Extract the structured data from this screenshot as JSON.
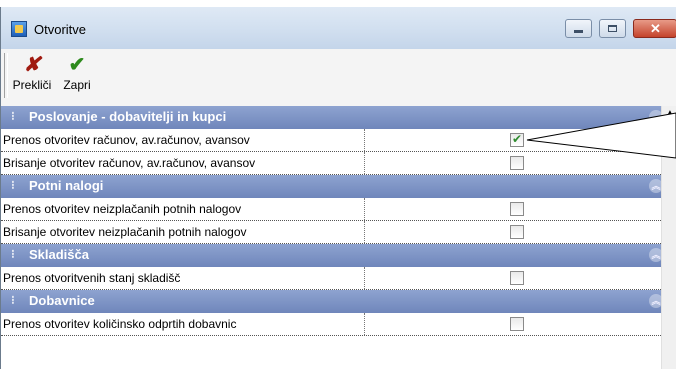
{
  "window": {
    "title": "Otvoritve"
  },
  "toolbar": {
    "cancel_label": "Prekliči",
    "close_label": "Zapri"
  },
  "groups": [
    {
      "title": "Poslovanje - dobavitelji in kupci",
      "items": [
        {
          "label": "Prenos otvoritev računov, av.računov, avansov",
          "checked": true
        },
        {
          "label": "Brisanje otvoritev računov, av.računov, avansov",
          "checked": false
        }
      ]
    },
    {
      "title": "Potni nalogi",
      "items": [
        {
          "label": "Prenos otvoritev neizplačanih potnih nalogov",
          "checked": false
        },
        {
          "label": "Brisanje otvoritev neizplačanih potnih nalogov",
          "checked": false
        }
      ]
    },
    {
      "title": "Skladišča",
      "items": [
        {
          "label": "Prenos otvoritvenih stanj skladišč",
          "checked": false
        }
      ]
    },
    {
      "title": "Dobavnice",
      "items": [
        {
          "label": "Prenos otvoritev količinsko odprtih dobavnic",
          "checked": false
        }
      ]
    }
  ]
}
